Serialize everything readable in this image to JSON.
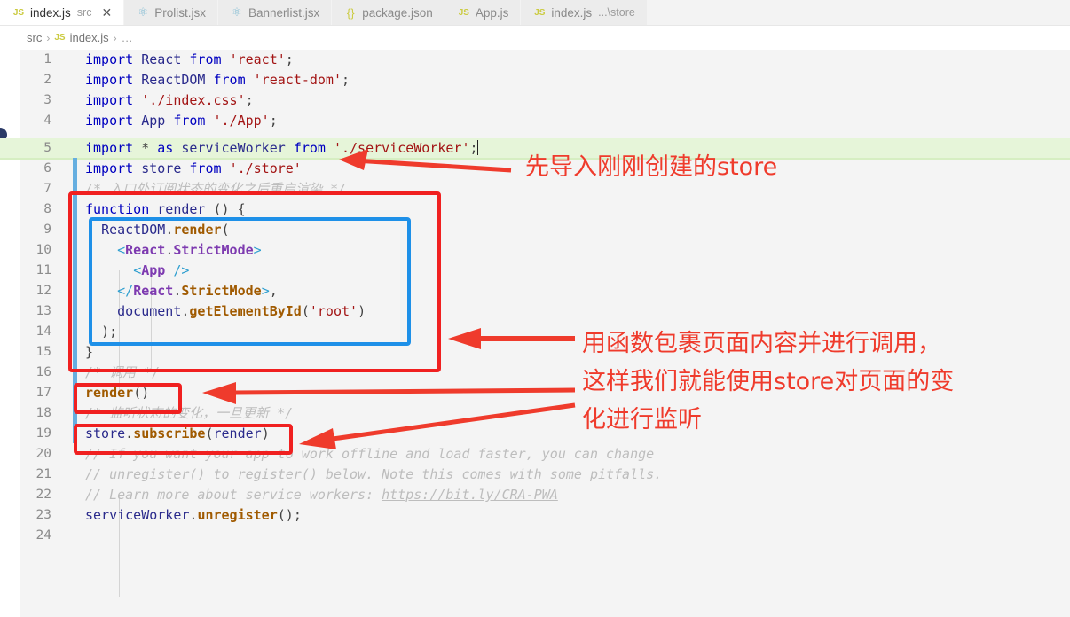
{
  "tabs": [
    {
      "icon": "js-file-icon",
      "icon_glyph": "JS",
      "icon_kind": "js",
      "name": "index.js",
      "sub": "src",
      "active": true,
      "close": "✕"
    },
    {
      "icon": "react-file-icon",
      "icon_glyph": "⚛",
      "icon_kind": "react",
      "name": "Prolist.jsx",
      "sub": "",
      "active": false,
      "close": ""
    },
    {
      "icon": "react-file-icon",
      "icon_glyph": "⚛",
      "icon_kind": "react",
      "name": "Bannerlist.jsx",
      "sub": "",
      "active": false,
      "close": ""
    },
    {
      "icon": "json-file-icon",
      "icon_glyph": "{}",
      "icon_kind": "json",
      "name": "package.json",
      "sub": "",
      "active": false,
      "close": ""
    },
    {
      "icon": "js-file-icon",
      "icon_glyph": "JS",
      "icon_kind": "js",
      "name": "App.js",
      "sub": "",
      "active": false,
      "close": ""
    },
    {
      "icon": "js-file-icon",
      "icon_glyph": "JS",
      "icon_kind": "js",
      "name": "index.js",
      "sub": "...\\store",
      "active": false,
      "close": ""
    }
  ],
  "breadcrumb": {
    "root": "src",
    "sep": "›",
    "file_icon": "JS",
    "file": "index.js",
    "tail": "…"
  },
  "editor": {
    "language": "javascript",
    "active_line": 5,
    "line_numbers": [
      "1",
      "2",
      "3",
      "4",
      "5",
      "6",
      "7",
      "8",
      "9",
      "10",
      "11",
      "12",
      "13",
      "14",
      "15",
      "16",
      "17",
      "18",
      "19",
      "20",
      "21",
      "22",
      "23",
      "24"
    ],
    "lines": [
      "import React from 'react';",
      "import ReactDOM from 'react-dom';",
      "import './index.css';",
      "import App from './App';",
      "import * as serviceWorker from './serviceWorker';",
      "import store from './store'",
      "/* 入口处订阅状态的变化之后重启渲染 */",
      "function render () {",
      "  ReactDOM.render(",
      "    <React.StrictMode>",
      "      <App />",
      "    </React.StrictMode>,",
      "    document.getElementById('root')",
      "  );",
      "}",
      "/* 调用 */",
      "render()",
      "/* 监听状态的变化，一旦更新 */",
      "store.subscribe(render)",
      "// If you want your app to work offline and load faster, you can change",
      "// unregister() to register() below. Note this comes with some pitfalls.",
      "// Learn more about service workers: https://bit.ly/CRA-PWA",
      "serviceWorker.unregister();",
      ""
    ],
    "link_in_line_22": "https://bit.ly/CRA-PWA"
  },
  "annotations": [
    {
      "id": "anno-1",
      "text": "先导入刚刚创建的store",
      "color": "#ef3b2c"
    },
    {
      "id": "anno-2-l1",
      "text": "用函数包裹页面内容并进行调用，",
      "color": "#ef3b2c"
    },
    {
      "id": "anno-2-l2",
      "text": "这样我们就能使用store对页面的变",
      "color": "#ef3b2c"
    },
    {
      "id": "anno-2-l3",
      "text": "化进行监听",
      "color": "#ef3b2c"
    }
  ],
  "colors": {
    "annotation_red": "#ef3b2c",
    "box_red": "#f02020",
    "box_blue": "#1e90e8",
    "gutter_change_blue": "#66aee0",
    "active_line_green": "#e6f5d9",
    "editor_bg": "#f4f4f4",
    "tab_active_bg": "#ffffff",
    "tab_inactive_bg": "#ececec"
  }
}
